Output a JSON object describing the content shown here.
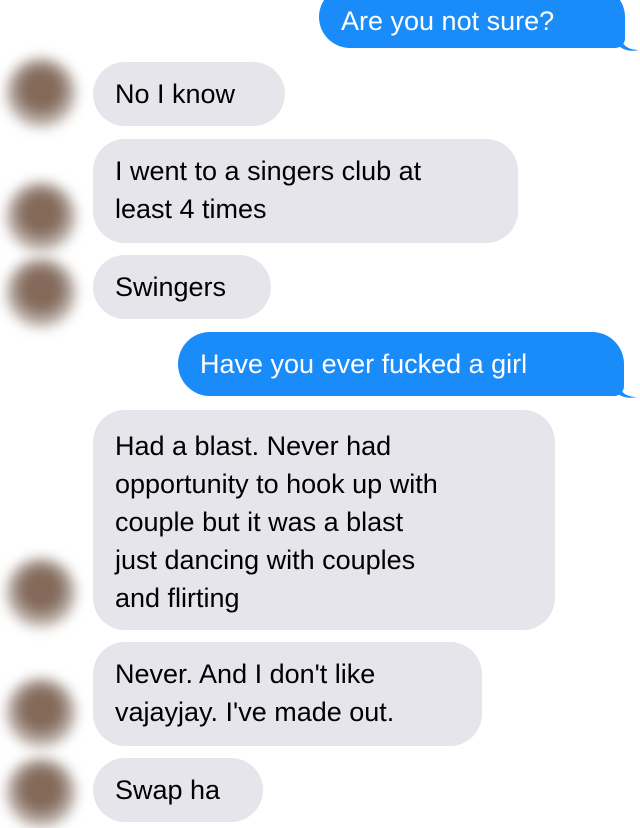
{
  "colors": {
    "outgoing_bubble": "#1a8cf9",
    "incoming_bubble": "#e6e5eb",
    "outgoing_text": "#ffffff",
    "incoming_text": "#000000"
  },
  "messages": [
    {
      "sender": "me",
      "text": "Are you not sure?"
    },
    {
      "sender": "them",
      "text": "No I know"
    },
    {
      "sender": "them",
      "text": "I went to a singers club at\nleast  4 times"
    },
    {
      "sender": "them",
      "text": "Swingers"
    },
    {
      "sender": "me",
      "text": "Have you ever fucked a girl"
    },
    {
      "sender": "them",
      "text": "Had a blast. Never had\nopportunity  to hook up with\ncouple but it was a blast\njust dancing with couples\nand flirting"
    },
    {
      "sender": "them",
      "text": "Never. And I don't like\nvajayjay. I've made out."
    },
    {
      "sender": "them",
      "text": "Swap ha"
    }
  ]
}
